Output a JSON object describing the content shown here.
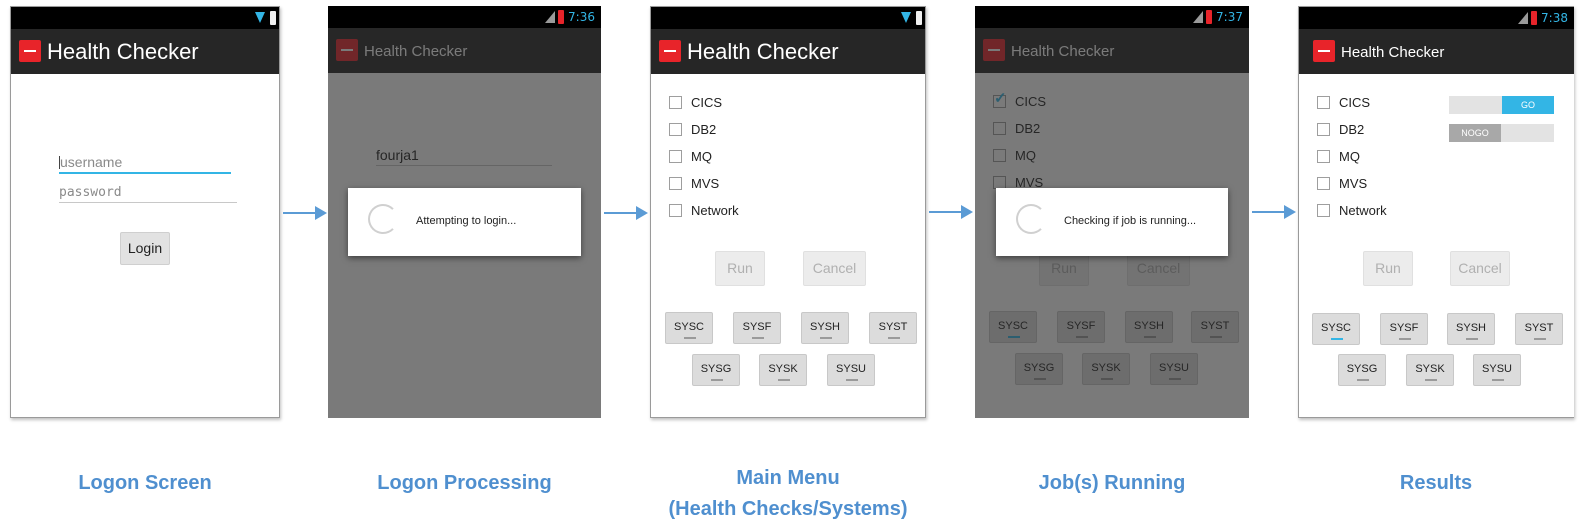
{
  "app_title": "Health Checker",
  "screens": {
    "logon": {
      "username_placeholder": "username",
      "password_placeholder": "password",
      "login_label": "Login",
      "caption": "Logon Screen"
    },
    "processing": {
      "time": "7:36",
      "username_value": "fourja1",
      "dialog_message": "Attempting to login...",
      "caption": "Logon Processing"
    },
    "main_menu": {
      "checks": [
        "CICS",
        "DB2",
        "MQ",
        "MVS",
        "Network"
      ],
      "run_label": "Run",
      "cancel_label": "Cancel",
      "systems": [
        "SYSC",
        "SYSF",
        "SYSH",
        "SYST",
        "SYSG",
        "SYSK",
        "SYSU"
      ],
      "caption_line1": "Main Menu",
      "caption_line2": "(Health Checks/Systems)"
    },
    "running": {
      "time": "7:37",
      "dialog_message": "Checking if job is running...",
      "caption": "Job(s) Running"
    },
    "results": {
      "time": "7:38",
      "go_label": "GO",
      "nogo_label": "NOGO",
      "caption": "Results"
    }
  },
  "colors": {
    "accent": "#33b5e5",
    "brand_red": "#e8242a",
    "caption": "#4f8fcf",
    "arrow": "#5b9bd5"
  }
}
